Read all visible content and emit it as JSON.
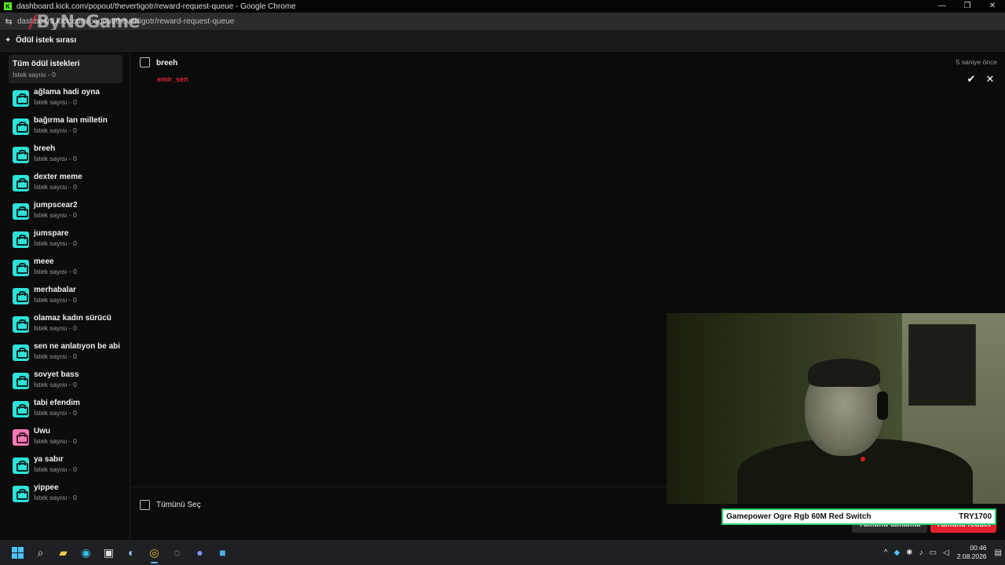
{
  "window": {
    "title": "dashboard.kick.com/popout/thevertigotr/reward-request-queue - Google Chrome",
    "url": "dashboard.kick.com/popout/thevertigotr/reward-request-queue",
    "controls": [
      "—",
      "❐",
      "✕"
    ]
  },
  "watermark": {
    "slash": "/",
    "text": "ByNoGame"
  },
  "header": {
    "icon": "reward-queue-icon",
    "title": "Ödül istek sırası"
  },
  "sidebar": {
    "all": {
      "name": "Tüm ödül istekleri",
      "count": "İstek sayısı - 0"
    },
    "items": [
      {
        "name": "ağlama hadi oyna",
        "count": "İstek sayısı - 0",
        "color": "#2de3d8"
      },
      {
        "name": "bağırma lan milletin",
        "count": "İstek sayısı - 0",
        "color": "#2de3d8"
      },
      {
        "name": "breeh",
        "count": "İstek sayısı - 0",
        "color": "#2de3d8"
      },
      {
        "name": "dexter meme",
        "count": "İstek sayısı - 0",
        "color": "#2de3d8"
      },
      {
        "name": "jumpscear2",
        "count": "İstek sayısı - 0",
        "color": "#2de3d8"
      },
      {
        "name": "jumspare",
        "count": "İstek sayısı - 0",
        "color": "#2de3d8"
      },
      {
        "name": "meee",
        "count": "İstek sayısı - 0",
        "color": "#2de3d8"
      },
      {
        "name": "merhabalar",
        "count": "İstek sayısı - 0",
        "color": "#2de3d8"
      },
      {
        "name": "olamaz kadın sürücü",
        "count": "İstek sayısı - 0",
        "color": "#2de3d8"
      },
      {
        "name": "sen ne anlatıyon be abi",
        "count": "İstek sayısı - 0",
        "color": "#2de3d8"
      },
      {
        "name": "sovyet bass",
        "count": "İstek sayısı - 0",
        "color": "#2de3d8"
      },
      {
        "name": "tabi efendim",
        "count": "İstek sayısı - 0",
        "color": "#2de3d8"
      },
      {
        "name": "Uwu",
        "count": "İstek sayısı - 0",
        "color": "#f47ab5"
      },
      {
        "name": "ya sabır",
        "count": "İstek sayısı - 0",
        "color": "#2de3d8"
      },
      {
        "name": "yippee",
        "count": "İstek sayısı - 0",
        "color": "#2de3d8"
      }
    ]
  },
  "request": {
    "title": "breeh",
    "user": "emir_sen",
    "time": "5 saniye önce",
    "accept": "✔",
    "reject": "✕"
  },
  "bottom": {
    "select_all": "Tümünü Seç",
    "complete_all": "Tümünü tamamla",
    "reject_all": "Tümünü reddet"
  },
  "ticker": {
    "product": "Gamepower Ogre Rgb 60M Red Switch",
    "price": "TRY1700"
  },
  "taskbar": {
    "icons": [
      "windows-start-icon",
      "search-icon",
      "file-explorer-icon",
      "edge-icon",
      "store-icon",
      "steam-icon",
      "chrome-icon",
      "obs-icon",
      "discord-icon",
      "app-icon"
    ],
    "tray": [
      "^"
    ],
    "time": "00:46",
    "date": "2.08.2026"
  }
}
